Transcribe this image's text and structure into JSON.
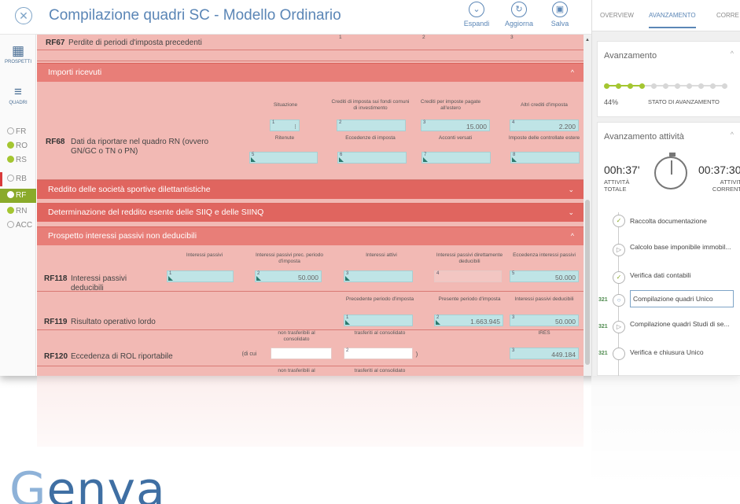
{
  "header": {
    "title": "Compilazione quadri SC - Modello Ordinario",
    "buttons": [
      {
        "label": "Espandi",
        "icon": "chevron-down-icon"
      },
      {
        "label": "Aggiorna",
        "icon": "refresh-icon"
      },
      {
        "label": "Salva",
        "icon": "save-icon"
      }
    ]
  },
  "leftnav": {
    "tools": [
      {
        "label": "PROSPETTI",
        "icon": "table-icon"
      },
      {
        "label": "QUADRI",
        "icon": "menu-icon"
      }
    ],
    "items": [
      {
        "label": "FR",
        "status": "empty"
      },
      {
        "label": "RO",
        "status": "done"
      },
      {
        "label": "RS",
        "status": "done"
      },
      {
        "label": "RB",
        "status": "empty"
      },
      {
        "label": "RF",
        "status": "active"
      },
      {
        "label": "RN",
        "status": "done"
      },
      {
        "label": "ACC",
        "status": "empty"
      }
    ]
  },
  "rf67": {
    "code": "RF67",
    "desc": "Perdite di periodi d'imposta precedenti",
    "fields": [
      "1",
      "2",
      "3"
    ]
  },
  "sections": {
    "importi": "Importi ricevuti",
    "sportive": "Reddito delle società sportive dilettantistiche",
    "siiq": "Determinazione del reddito esente delle SIIQ e delle SIINQ",
    "interessi": "Prospetto interessi passivi non deducibili"
  },
  "rf68": {
    "code": "RF68",
    "desc": "Dati da riportare nel quadro RN (ovvero GN/GC o TN o PN)",
    "labels1": [
      "Situazione",
      "Crediti di imposta sui fondi comuni di investimento",
      "Crediti per imposte pagate all'estero",
      "Altri crediti d'imposta"
    ],
    "values1": [
      {
        "n": "1",
        "v": ""
      },
      {
        "n": "2",
        "v": ""
      },
      {
        "n": "3",
        "v": "15.000"
      },
      {
        "n": "4",
        "v": "2.200"
      }
    ],
    "labels2": [
      "Ritenute",
      "Eccedenze di imposta",
      "Acconti versati",
      "Imposte delle controllate estere"
    ],
    "values2": [
      {
        "n": "5",
        "v": ""
      },
      {
        "n": "6",
        "v": ""
      },
      {
        "n": "7",
        "v": ""
      },
      {
        "n": "8",
        "v": ""
      }
    ]
  },
  "rf118": {
    "code": "RF118",
    "desc": "Interessi passivi deducibili",
    "labels": [
      "Interessi passivi",
      "Interessi passivi prec. periodo d'imposta",
      "Interessi attivi",
      "Interessi passivi direttamente deducibili",
      "Eccedenza interessi passivi"
    ],
    "values": [
      {
        "n": "1",
        "v": ""
      },
      {
        "n": "2",
        "v": "50.000"
      },
      {
        "n": "3",
        "v": ""
      },
      {
        "n": "4",
        "v": ""
      },
      {
        "n": "5",
        "v": "50.000"
      }
    ]
  },
  "rf119": {
    "code": "RF119",
    "desc": "Risultato operativo lordo",
    "labels": [
      "Precedente periodo d'imposta",
      "Presente periodo d'imposta",
      "Interessi passivi deducibili"
    ],
    "values": [
      {
        "n": "1",
        "v": ""
      },
      {
        "n": "2",
        "v": "1.663.945"
      },
      {
        "n": "3",
        "v": "50.000"
      }
    ]
  },
  "rf120": {
    "code": "RF120",
    "desc": "Eccedenza di  ROL riportabile",
    "labels": [
      "non trasferibili al consolidato",
      "trasferiti al consolidato",
      "IRES"
    ],
    "dicui": "(di cui",
    "paren": ")",
    "values": [
      {
        "n": "",
        "v": ""
      },
      {
        "n": "2",
        "v": ""
      },
      {
        "n": "3",
        "v": "449.184"
      }
    ],
    "next_labels": [
      "non trasferibili al",
      "trasferiti al consolidato"
    ]
  },
  "right": {
    "tabs": [
      "OVERVIEW",
      "AVANZAMENTO",
      "CORRE"
    ],
    "progress": {
      "title": "Avanzamento",
      "percent": "44%",
      "label": "STATO DI AVANZAMENTO",
      "filled": 4,
      "total": 11
    },
    "activity": {
      "title": "Avanzamento attività",
      "total_time": "00h:37'",
      "total_label": "ATTIVITÀ TOTALE",
      "current_time": "00:37:30",
      "current_label": "ATTIVITÀ CORRENTE"
    },
    "steps": [
      {
        "label": "Raccolta documentazione",
        "icon": "check-icon",
        "flag": ""
      },
      {
        "label": "Calcolo base imponibile immobil...",
        "icon": "play-icon",
        "flag": ""
      },
      {
        "label": "Verifica dati contabili",
        "icon": "check-icon",
        "flag": ""
      },
      {
        "label": "Compilazione quadri Unico",
        "icon": "circle-icon",
        "flag": "321"
      },
      {
        "label": "Compilazione quadri Studi di se...",
        "icon": "play-icon",
        "flag": "321"
      },
      {
        "label": "Verifica e chiusura Unico",
        "icon": "circle-icon",
        "flag": "321"
      }
    ]
  },
  "brand": {
    "first": "G",
    "rest": "enya"
  }
}
